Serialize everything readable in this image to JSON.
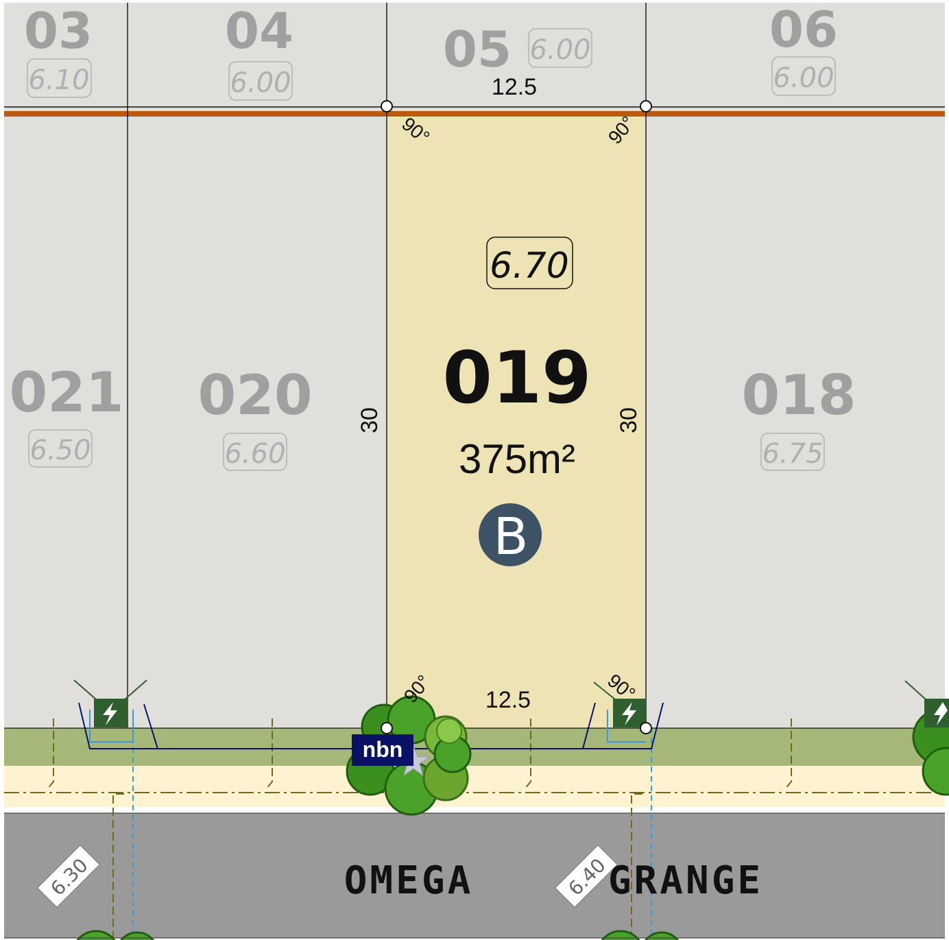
{
  "rear_lots": [
    {
      "number": "03",
      "level": "6.10"
    },
    {
      "number": "04",
      "level": "6.00"
    },
    {
      "number": "05",
      "level": "6.00"
    },
    {
      "number": "06",
      "level": "6.00"
    }
  ],
  "front_lots": [
    {
      "number": "021",
      "level": "6.50"
    },
    {
      "number": "020",
      "level": "6.60"
    },
    {
      "number": "018",
      "level": "6.75"
    }
  ],
  "featured_lot": {
    "number": "019",
    "area": "375m²",
    "level": "6.70",
    "badge": "B",
    "frontage_top": "12.5",
    "frontage_bottom": "12.5",
    "depth_left": "30",
    "depth_right": "30",
    "angle": "90°"
  },
  "utility": {
    "nbn_label": "nbn"
  },
  "road": {
    "name_left": "OMEGA",
    "name_right": "GRANGE",
    "level_left": "6.30",
    "level_right": "6.40"
  },
  "colors": {
    "lot_grey": "#e0dfdc",
    "featured_fill": "#ede3b5",
    "rear_boundary": "#b85a10",
    "verge_green": "#a5b87a",
    "footpath": "#fdf3d1",
    "road": "#9a9a9a",
    "badge": "#3d5265",
    "nbn": "#0b1266",
    "power_box": "#2f5e2f"
  }
}
